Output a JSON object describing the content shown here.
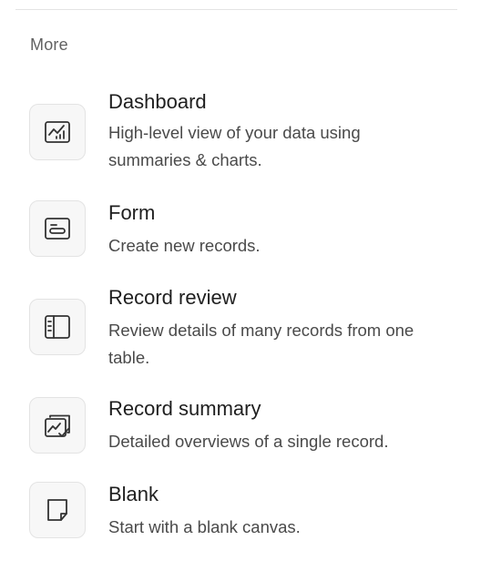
{
  "section": {
    "title": "More"
  },
  "items": [
    {
      "title": "Dashboard",
      "description": "High-level view of your data using summaries & charts.",
      "icon": "chart-icon"
    },
    {
      "title": "Form",
      "description": "Create new records.",
      "icon": "form-icon"
    },
    {
      "title": "Record review",
      "description": "Review details of many records from one table.",
      "icon": "sidebar-layout-icon"
    },
    {
      "title": "Record summary",
      "description": "Detailed overviews of a single record.",
      "icon": "image-check-icon"
    },
    {
      "title": "Blank",
      "description": "Start with a blank canvas.",
      "icon": "blank-page-icon"
    }
  ],
  "colors": {
    "text_primary": "#1f1f1f",
    "text_secondary": "#4a4a4a",
    "section_title": "#616161",
    "icon_stroke": "#333333",
    "tile_border": "#e3e3e3",
    "tile_background": "#f7f7f7"
  }
}
